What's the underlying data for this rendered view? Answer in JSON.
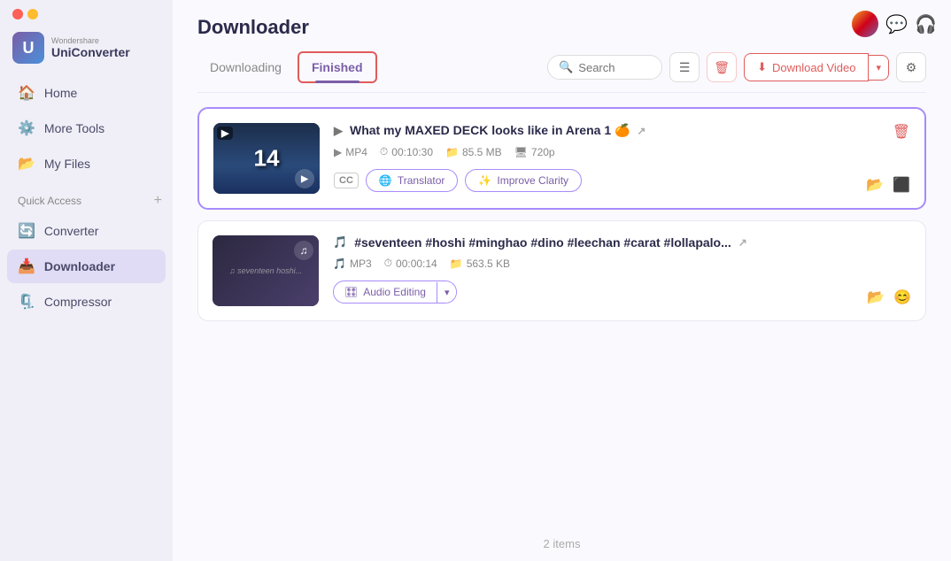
{
  "app": {
    "brand": "Wondershare",
    "name": "UniConverter"
  },
  "traffic_lights": {
    "red": "#fe5f57",
    "yellow": "#febc2e",
    "green": "#28c840"
  },
  "sidebar": {
    "nav_items": [
      {
        "id": "home",
        "label": "Home",
        "icon": "🏠"
      },
      {
        "id": "more-tools",
        "label": "More Tools",
        "icon": "🔧"
      },
      {
        "id": "my-files",
        "label": "My Files",
        "icon": "📁"
      }
    ],
    "section_label": "Quick Access",
    "section_items": [
      {
        "id": "converter",
        "label": "Converter",
        "icon": "🔄"
      },
      {
        "id": "downloader",
        "label": "Downloader",
        "icon": "📥",
        "active": true
      },
      {
        "id": "compressor",
        "label": "Compressor",
        "icon": "🗜️"
      }
    ]
  },
  "page": {
    "title": "Downloader",
    "tabs": [
      {
        "id": "downloading",
        "label": "Downloading",
        "active": false
      },
      {
        "id": "finished",
        "label": "Finished",
        "active": true
      }
    ]
  },
  "toolbar": {
    "search_placeholder": "Search",
    "download_video_label": "Download Video"
  },
  "items": [
    {
      "id": "item-1",
      "type": "video",
      "title": "What my MAXED DECK looks like in Arena 1 🍊",
      "format": "MP4",
      "duration": "00:10:30",
      "size": "85.5 MB",
      "resolution": "720p",
      "actions": [
        "CC",
        "Translator",
        "Improve Clarity"
      ],
      "thumb_number": "14"
    },
    {
      "id": "item-2",
      "type": "audio",
      "title": "#seventeen #hoshi #minghao #dino #leechan #carat #lollapalo...",
      "format": "MP3",
      "duration": "00:00:14",
      "size": "563.5 KB",
      "actions": [
        "Audio Editing"
      ]
    }
  ],
  "footer": {
    "count_label": "2 items"
  }
}
